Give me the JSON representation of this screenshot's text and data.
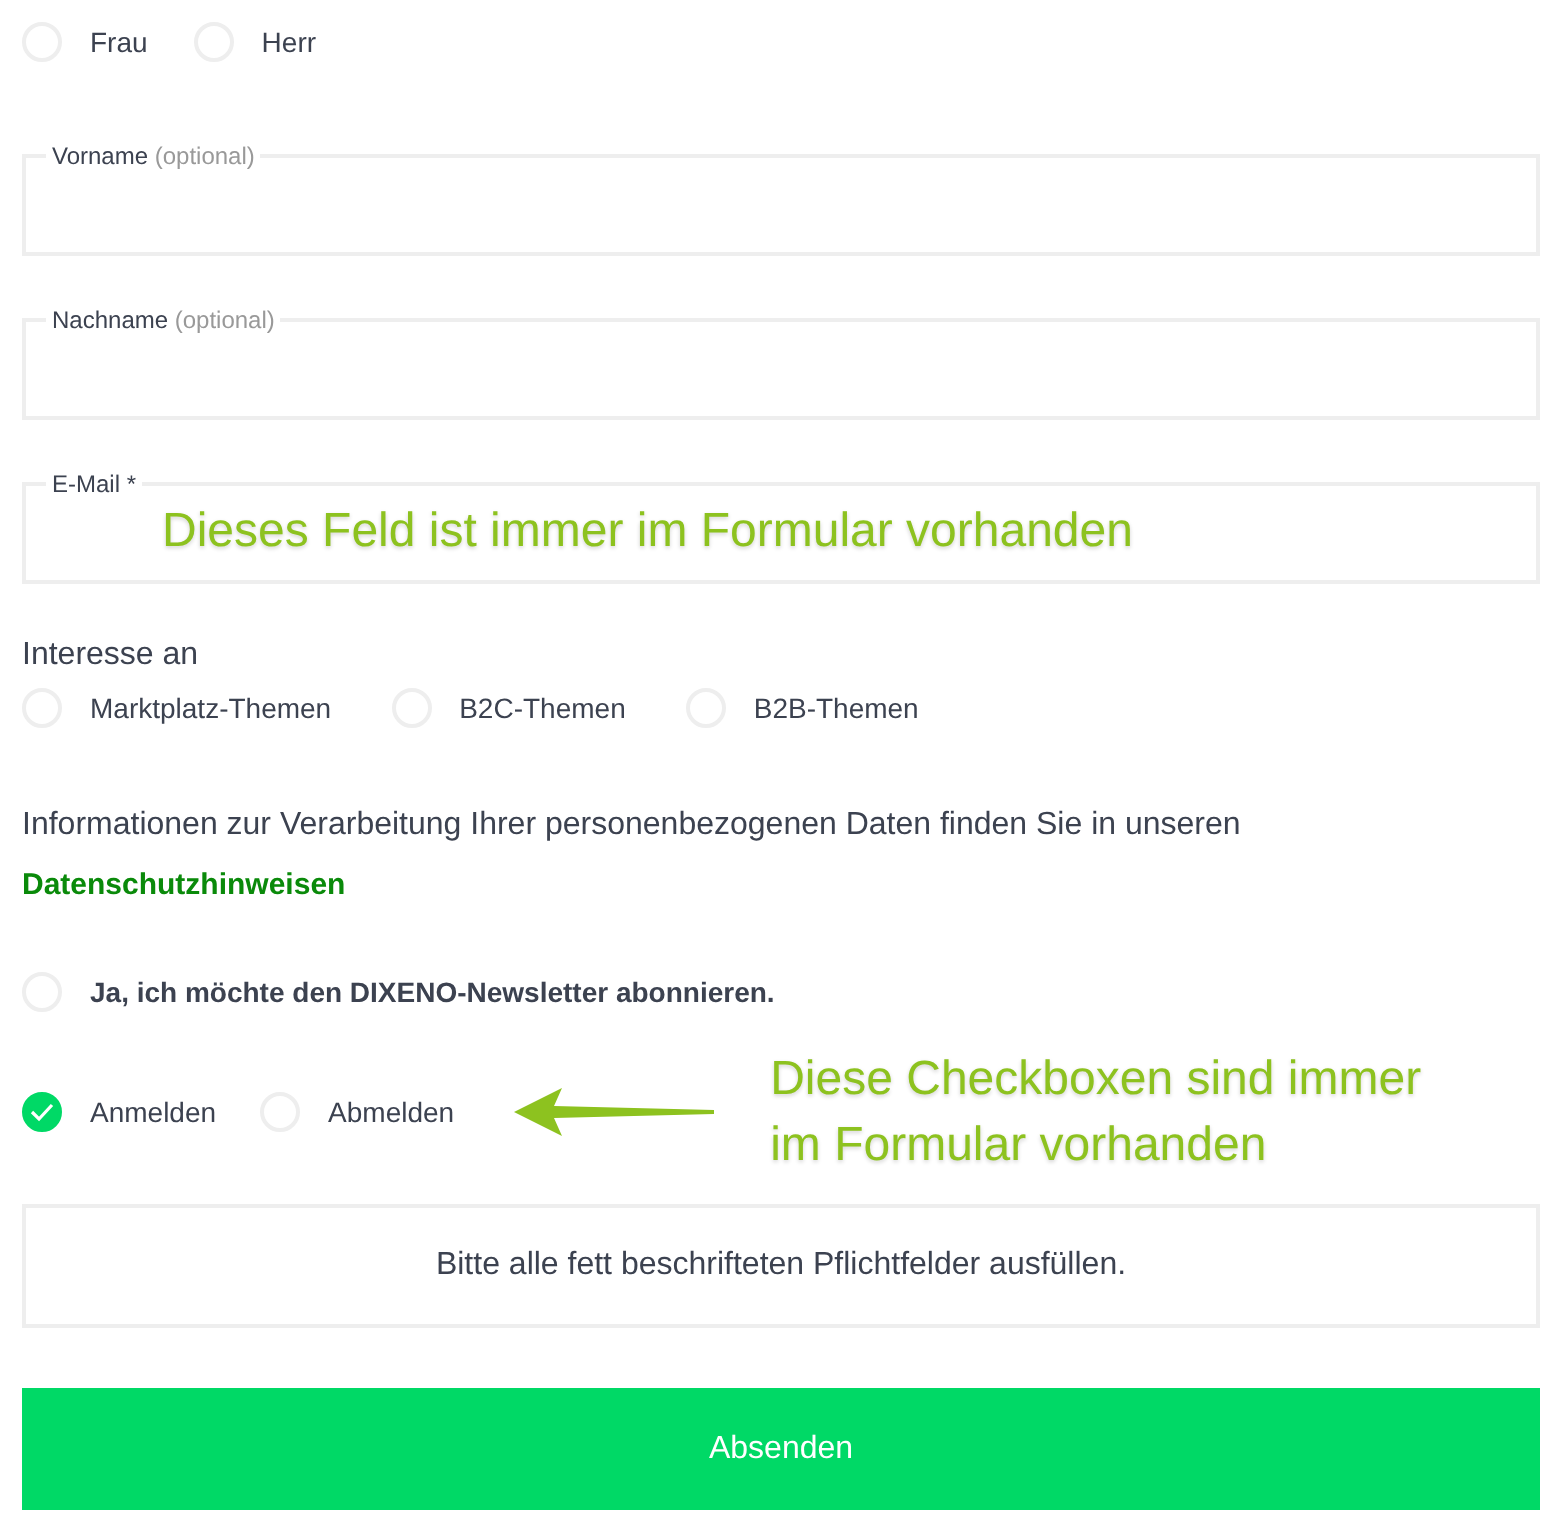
{
  "salutation": [
    {
      "label": "Frau",
      "selected": false
    },
    {
      "label": "Herr",
      "selected": false
    }
  ],
  "fields": [
    {
      "label": "Vorname",
      "hint": "(optional)"
    },
    {
      "label": "Nachname",
      "hint": "(optional)"
    },
    {
      "label": "E-Mail *",
      "annotation": "Dieses Feld ist immer im Formular vorhanden"
    }
  ],
  "interests": {
    "title": "Interesse an",
    "options": [
      {
        "label": "Marktplatz-Themen",
        "checked": false
      },
      {
        "label": "B2C-Themen",
        "checked": false
      },
      {
        "label": "B2B-Themen",
        "checked": false
      }
    ]
  },
  "privacy": {
    "text": "Informationen zur Verarbeitung Ihrer personenbezogenen Daten finden Sie in unseren",
    "link": "Datenschutzhinweisen"
  },
  "newsletter": {
    "label": "Ja, ich möchte den DIXENO-Newsletter abonnieren.",
    "checked": false
  },
  "subscription": {
    "options": [
      {
        "label": "Anmelden",
        "checked": true
      },
      {
        "label": "Abmelden",
        "checked": false
      }
    ],
    "annotation": "Diese Checkboxen sind immer im Formular vorhanden"
  },
  "notice": "Bitte alle fett beschrifteten Pflichtfelder ausfüllen.",
  "submit": "Absenden"
}
